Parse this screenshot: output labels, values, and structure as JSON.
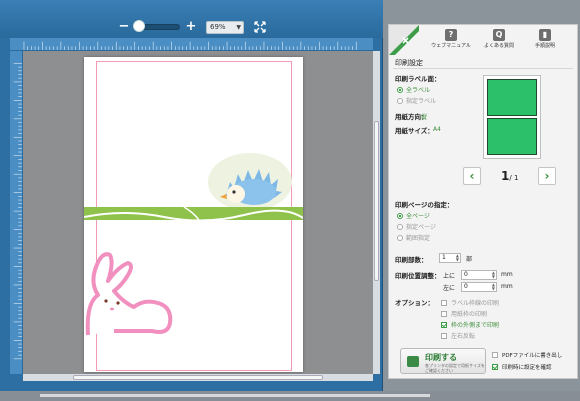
{
  "editor": {
    "zoom": {
      "minus": "−",
      "plus": "+",
      "value": "69%"
    }
  },
  "panel": {
    "help": {
      "manual": "ウェブマニュアル",
      "faq": "よくある質問",
      "guide": "手順説明"
    },
    "title": "印刷設定",
    "print_label_side": {
      "heading": "印刷ラベル面：",
      "options": [
        "全ラベル",
        "指定ラベル"
      ]
    },
    "paper_orientation": {
      "label": "用紙方向：",
      "value": "縦"
    },
    "paper_size": {
      "label": "用紙サイズ：",
      "value": "A4"
    },
    "pager": {
      "prev": "‹",
      "next": "›",
      "current": "1",
      "total": "/ 1"
    },
    "page_spec": {
      "heading": "印刷ページの指定：",
      "options": [
        "全ページ",
        "指定ページ",
        "範囲指定"
      ]
    },
    "copies": {
      "label": "印刷部数：",
      "value": "1",
      "unit": "部"
    },
    "position": {
      "label": "印刷位置調整：",
      "top_label": "上に",
      "top_value": "0",
      "left_label": "左に",
      "left_value": "0",
      "unit": "mm"
    },
    "options": {
      "heading": "オプション：",
      "items": [
        "ラベル枠線の印刷",
        "用紙枠の印刷",
        "枠の外側まで印刷",
        "左右反転"
      ]
    },
    "print_button": {
      "label": "印刷する",
      "sub": "各プリンタの設定で用紙サイズをご確認ください"
    },
    "side_checks": [
      "PDFファイルに書き出し",
      "印刷時に設定を確認"
    ]
  },
  "colors": {
    "accent": "#3d9d48",
    "editor_blue": "#2d6fa3"
  }
}
